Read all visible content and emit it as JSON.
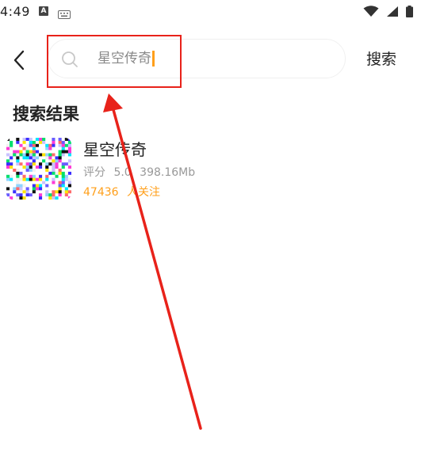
{
  "status_bar": {
    "time": "4:49",
    "icons": [
      "accessibility-a-icon",
      "keyboard-icon",
      "wifi-icon",
      "signal-icon",
      "battery-icon"
    ]
  },
  "header": {
    "back_icon": "chevron-left-icon",
    "search": {
      "value": "星空传奇",
      "icon": "search-icon"
    },
    "search_button_label": "搜索"
  },
  "results": {
    "title": "搜索结果",
    "items": [
      {
        "name": "星空传奇",
        "rating_label": "评分",
        "rating": "5.0",
        "size": "398.16Mb",
        "followers": "47436",
        "followers_suffix": "人关注"
      }
    ]
  },
  "colors": {
    "accent": "#ff9f1a",
    "annotation_red": "#e8221a",
    "text_primary": "#222222",
    "text_secondary": "#999999"
  }
}
